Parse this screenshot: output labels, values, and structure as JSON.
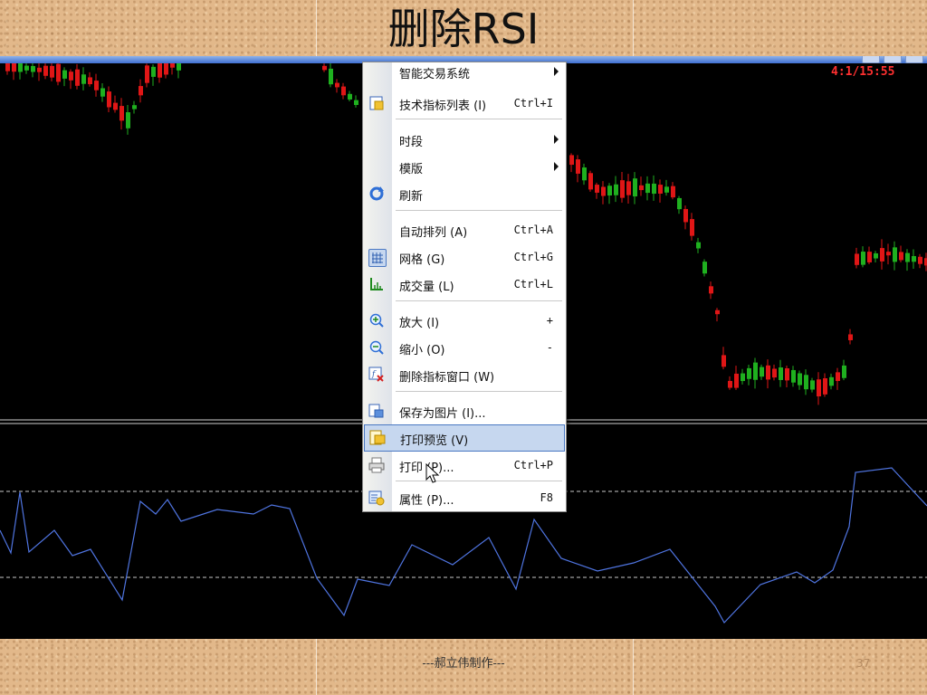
{
  "slide": {
    "title": "删除RSI",
    "footer": "---郝立伟制作---",
    "page_number": "37"
  },
  "terminal": {
    "clock": "4:1/15:55"
  },
  "context_menu": {
    "items": [
      {
        "label": "智能交易系统",
        "shortcut": "",
        "icon": "",
        "submenu": true
      },
      {
        "label": "技术指标列表 (I)",
        "shortcut": "Ctrl+I",
        "icon": "indicator-list-icon",
        "submenu": false
      },
      {
        "label": "时段",
        "shortcut": "",
        "icon": "",
        "submenu": true
      },
      {
        "label": "模版",
        "shortcut": "",
        "icon": "",
        "submenu": true
      },
      {
        "label": "刷新",
        "shortcut": "",
        "icon": "refresh-icon",
        "submenu": false
      },
      {
        "label": "自动排列 (A)",
        "shortcut": "Ctrl+A",
        "icon": "",
        "submenu": false
      },
      {
        "label": "网格 (G)",
        "shortcut": "Ctrl+G",
        "icon": "grid-icon",
        "submenu": false
      },
      {
        "label": "成交量 (L)",
        "shortcut": "Ctrl+L",
        "icon": "volume-icon",
        "submenu": false
      },
      {
        "label": "放大 (I)",
        "shortcut": "+",
        "icon": "zoom-in-icon",
        "submenu": false
      },
      {
        "label": "缩小 (O)",
        "shortcut": "-",
        "icon": "zoom-out-icon",
        "submenu": false
      },
      {
        "label": "删除指标窗口 (W)",
        "shortcut": "",
        "icon": "delete-indicator-window-icon",
        "submenu": false
      },
      {
        "label": "保存为图片 (I)...",
        "shortcut": "",
        "icon": "save-image-icon",
        "submenu": false
      },
      {
        "label": "打印预览 (V)",
        "shortcut": "",
        "icon": "print-preview-icon",
        "submenu": false,
        "highlighted": true
      },
      {
        "label": "打印 (P)...",
        "shortcut": "Ctrl+P",
        "icon": "print-icon",
        "submenu": false
      },
      {
        "label": "属性 (P)...",
        "shortcut": "F8",
        "icon": "properties-icon",
        "submenu": false
      }
    ]
  },
  "colors": {
    "bull_candle": "#1fb01f",
    "bear_candle": "#e01616",
    "rsi_line": "#4f74e0",
    "menu_highlight": "#c6d7ef"
  }
}
